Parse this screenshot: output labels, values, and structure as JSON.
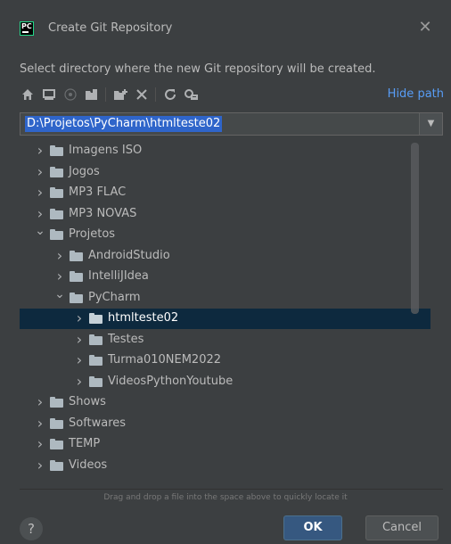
{
  "window": {
    "title": "Create Git Repository",
    "close_glyph": "✕"
  },
  "description": "Select directory where the new Git repository will be created.",
  "toolbar": {
    "icons": [
      "home-icon",
      "desktop-icon",
      "project-icon",
      "module-icon",
      "new-folder-icon",
      "delete-icon",
      "refresh-icon",
      "show-hidden-icon"
    ],
    "hide_path_label": "Hide path"
  },
  "path": {
    "value": "D:\\Projetos\\PyCharm\\htmlteste02",
    "dropdown_glyph": "▼"
  },
  "tree": {
    "items": [
      {
        "label": "Imagens ISO",
        "depth": 1,
        "expanded": false,
        "selected": false
      },
      {
        "label": "Jogos",
        "depth": 1,
        "expanded": false,
        "selected": false
      },
      {
        "label": "MP3 FLAC",
        "depth": 1,
        "expanded": false,
        "selected": false
      },
      {
        "label": "MP3 NOVAS",
        "depth": 1,
        "expanded": false,
        "selected": false
      },
      {
        "label": "Projetos",
        "depth": 1,
        "expanded": true,
        "selected": false
      },
      {
        "label": "AndroidStudio",
        "depth": 2,
        "expanded": false,
        "selected": false
      },
      {
        "label": "IntelliJIdea",
        "depth": 2,
        "expanded": false,
        "selected": false
      },
      {
        "label": "PyCharm",
        "depth": 2,
        "expanded": true,
        "selected": false
      },
      {
        "label": "htmlteste02",
        "depth": 3,
        "expanded": false,
        "selected": true
      },
      {
        "label": "Testes",
        "depth": 3,
        "expanded": false,
        "selected": false
      },
      {
        "label": "Turma010NEM2022",
        "depth": 3,
        "expanded": false,
        "selected": false
      },
      {
        "label": "VideosPythonYoutube",
        "depth": 3,
        "expanded": false,
        "selected": false
      },
      {
        "label": "Shows",
        "depth": 1,
        "expanded": false,
        "selected": false
      },
      {
        "label": "Softwares",
        "depth": 1,
        "expanded": false,
        "selected": false
      },
      {
        "label": "TEMP",
        "depth": 1,
        "expanded": false,
        "selected": false
      },
      {
        "label": "Videos",
        "depth": 1,
        "expanded": false,
        "selected": false
      }
    ]
  },
  "hint": "Drag and drop a file into the space above to quickly locate it",
  "buttons": {
    "help": "?",
    "ok": "OK",
    "cancel": "Cancel"
  },
  "colors": {
    "background": "#3c3f41",
    "selection": "#0d293e",
    "path_selection": "#2f65ca",
    "link": "#589df6",
    "ok_button": "#365880"
  }
}
